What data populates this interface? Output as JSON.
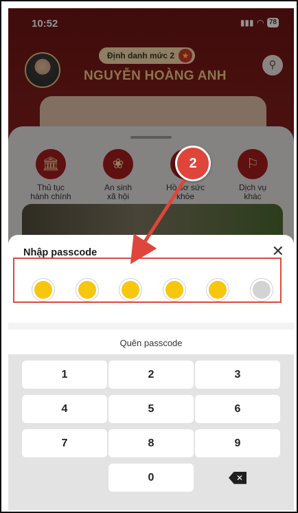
{
  "status_bar": {
    "time": "10:52",
    "battery": "78"
  },
  "profile": {
    "level_badge": "Định danh mức 2",
    "name": "NGUYỄN HOÀNG ANH"
  },
  "categories": [
    {
      "label": "Thủ tục\nhành chính",
      "icon": "building-icon"
    },
    {
      "label": "An sinh\nxã hội",
      "icon": "people-icon"
    },
    {
      "label": "Hồ sơ sức\nkhỏe",
      "icon": "health-icon"
    },
    {
      "label": "Dịch vụ\nkhác",
      "icon": "services-icon"
    }
  ],
  "passcode_modal": {
    "title": "Nhập passcode",
    "close_icon": "close-icon",
    "dots": [
      "filled",
      "filled",
      "filled",
      "filled",
      "filled",
      "empty"
    ],
    "forgot_label": "Quên passcode"
  },
  "keypad": {
    "keys": [
      "1",
      "2",
      "3",
      "4",
      "5",
      "6",
      "7",
      "8",
      "9",
      "",
      "0",
      "⌫"
    ]
  },
  "annotation": {
    "step": "2",
    "color": "#e0453b"
  },
  "colors": {
    "primary": "#a41d1c",
    "dot_filled": "#f7c60f",
    "dot_empty": "#d3d3d3"
  }
}
